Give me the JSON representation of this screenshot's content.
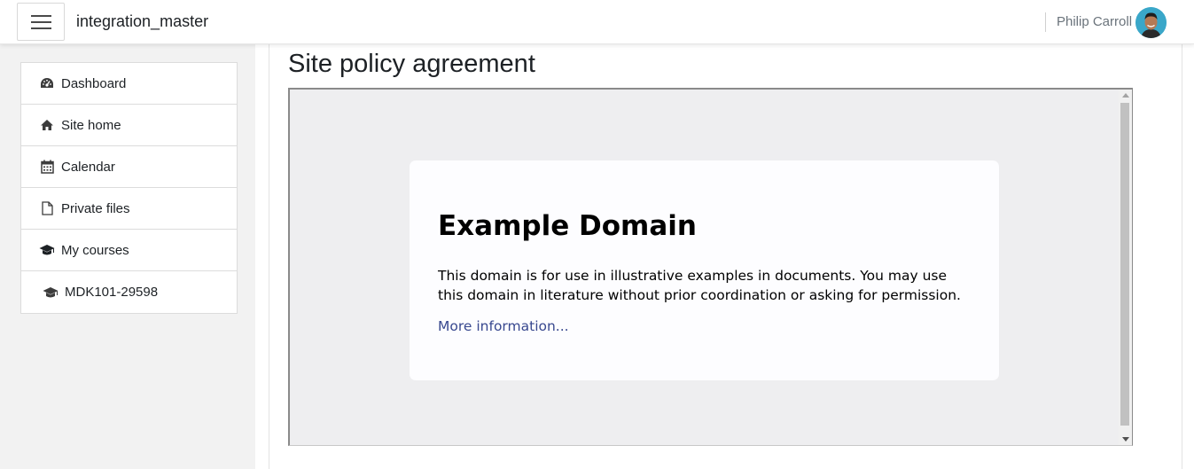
{
  "header": {
    "menu_icon": "hamburger-icon",
    "site_name": "integration_master",
    "user_name": "Philip Carroll",
    "avatar": "user-avatar"
  },
  "sidebar": {
    "items": [
      {
        "label": "Dashboard",
        "icon": "dashboard-icon"
      },
      {
        "label": "Site home",
        "icon": "home-icon"
      },
      {
        "label": "Calendar",
        "icon": "calendar-icon"
      },
      {
        "label": "Private files",
        "icon": "file-icon"
      },
      {
        "label": "My courses",
        "icon": "graduation-cap-icon"
      },
      {
        "label": "MDK101-29598",
        "icon": "graduation-cap-icon"
      }
    ]
  },
  "main": {
    "page_title": "Site policy agreement",
    "policy_frame": {
      "heading": "Example Domain",
      "body": "This domain is for use in illustrative examples in documents. You may use this domain in literature without prior coordination or asking for permission.",
      "link": "More information..."
    }
  },
  "colors": {
    "drawer_bg": "#f2f2f2",
    "frame_bg": "#eeeef0",
    "link": "#38488f"
  }
}
